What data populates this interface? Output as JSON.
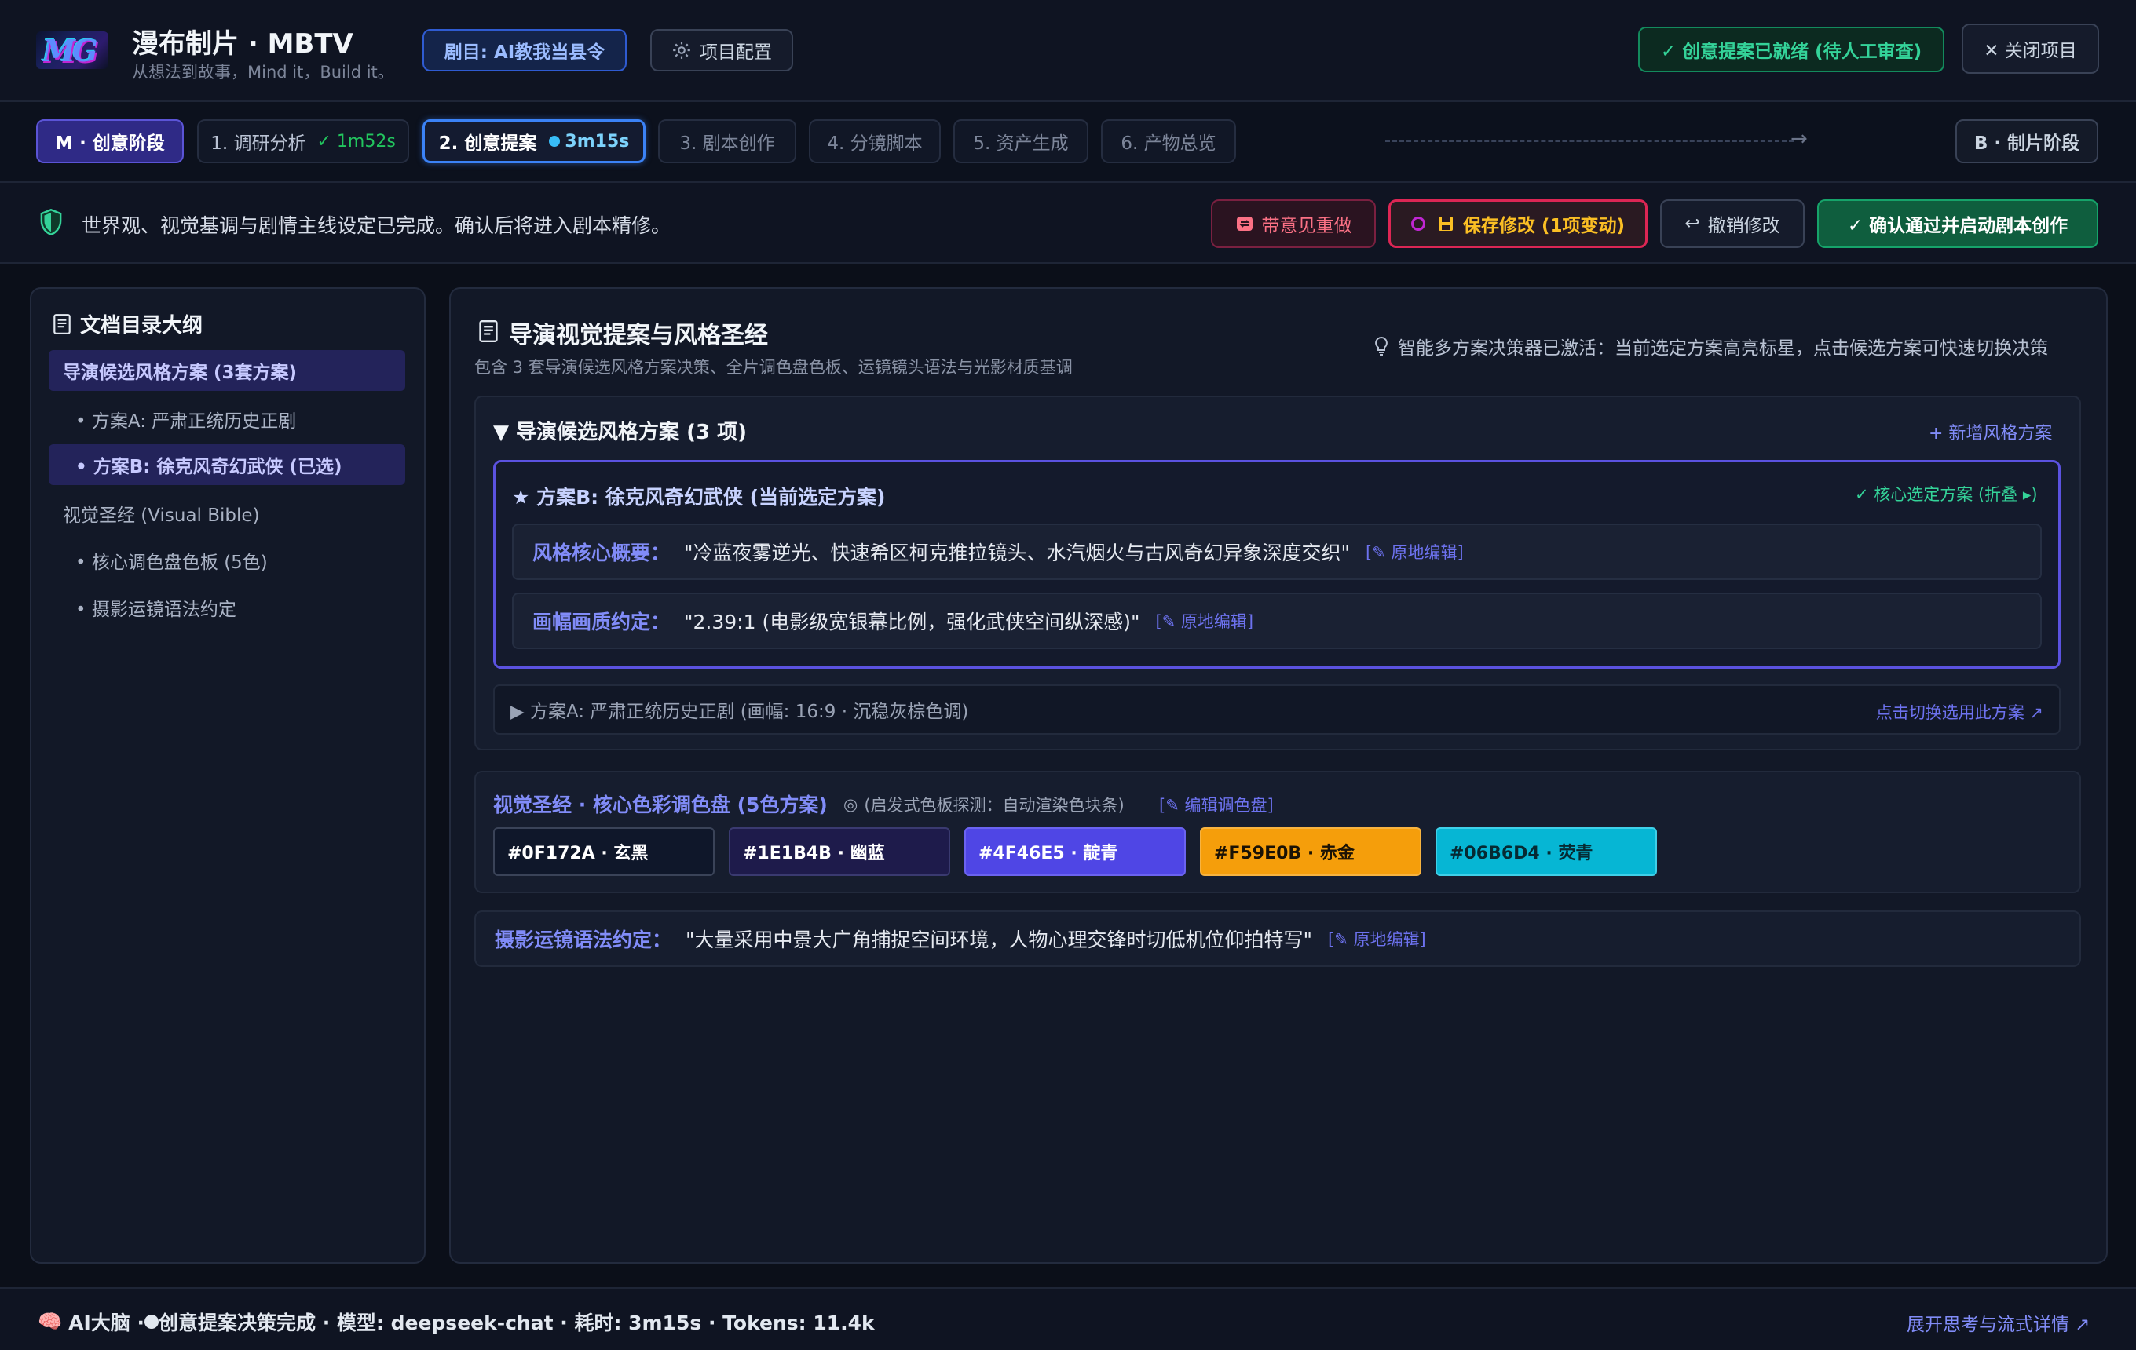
{
  "header": {
    "logo_text": "MG",
    "app_title": "漫布制片 · MBTV",
    "app_subtitle": "从想法到故事，Mind it，Build it。",
    "drama_chip": "剧目: AI教我当县令",
    "project_config": "项目配置",
    "ready_status": "✓ 创意提案已就绪 (待人工审查)",
    "close_project": "✕ 关闭项目"
  },
  "stages": {
    "m_stage": "M · 创意阶段",
    "b_stage": "B · 制片阶段",
    "steps": [
      {
        "label": "1. 调研分析",
        "time": "✓ 1m52s",
        "state": "done"
      },
      {
        "label": "2. 创意提案",
        "time": "3m15s",
        "state": "active"
      },
      {
        "label": "3. 剧本创作",
        "state": "pending"
      },
      {
        "label": "4. 分镜脚本",
        "state": "pending"
      },
      {
        "label": "5. 资产生成",
        "state": "pending"
      },
      {
        "label": "6. 产物总览",
        "state": "pending"
      }
    ]
  },
  "action_bar": {
    "message": "世界观、视觉基调与剧情主线设定已完成。确认后将进入剧本精修。",
    "redo": "带意见重做",
    "save": "保存修改 (1项变动)",
    "undo": "撤销修改",
    "confirm": "✓ 确认通过并启动剧本创作"
  },
  "sidebar": {
    "title": "文档目录大纲",
    "items": [
      {
        "label": "导演候选风格方案 (3套方案)",
        "active": true,
        "sub": false
      },
      {
        "label": "• 方案A: 严肃正统历史正剧",
        "active": false,
        "sub": true
      },
      {
        "label": "• 方案B: 徐克风奇幻武侠 (已选)",
        "active": true,
        "sub": true
      },
      {
        "label": "视觉圣经 (Visual Bible)",
        "active": false,
        "sub": false
      },
      {
        "label": "• 核心调色盘色板 (5色)",
        "active": false,
        "sub": true
      },
      {
        "label": "• 摄影运镜语法约定",
        "active": false,
        "sub": true
      }
    ]
  },
  "main": {
    "title": "导演视觉提案与风格圣经",
    "subtitle": "包含 3 套导演候选风格方案决策、全片调色盘色板、运镜镜头语法与光影材质基调",
    "hint": "智能多方案决策器已激活：当前选定方案高亮标星，点击候选方案可快速切换决策",
    "group_title": "▼ 导演候选风格方案 (3 项)",
    "add_style": "+ 新增风格方案",
    "selected": {
      "title": "★ 方案B: 徐克风奇幻武侠 (当前选定方案)",
      "badge": "✓ 核心选定方案 (折叠 ▸)",
      "fields": [
        {
          "label": "风格核心概要：",
          "value": "\"冷蓝夜雾逆光、快速希区柯克推拉镜头、水汽烟火与古风奇幻异象深度交织\"",
          "edit": "[✎ 原地编辑]"
        },
        {
          "label": "画幅画质约定：",
          "value": "\"2.39:1 (电影级宽银幕比例，强化武侠空间纵深感)\"",
          "edit": "[✎ 原地编辑]"
        }
      ]
    },
    "alternative": {
      "label": "▶ 方案A: 严肃正统历史正剧 (画幅: 16:9 · 沉稳灰棕色调)",
      "switch": "点击切换选用此方案 ↗"
    },
    "palette": {
      "title": "视觉圣经 · 核心色彩调色盘 (5色方案)",
      "note": "(启发式色板探测：自动渲染色块条)",
      "edit": "[✎ 编辑调色盘]",
      "swatches": [
        {
          "label": "#0F172A · 玄黑",
          "bg": "#0F172A",
          "fg": "#ffffff",
          "border": "#3a4358"
        },
        {
          "label": "#1E1B4B · 幽蓝",
          "bg": "#1E1B4B",
          "fg": "#ffffff",
          "border": "#3a3a70"
        },
        {
          "label": "#4F46E5 · 靛青",
          "bg": "#4F46E5",
          "fg": "#ffffff",
          "border": "#6b63f0"
        },
        {
          "label": "#F59E0B · 赤金",
          "bg": "#F59E0B",
          "fg": "#1a1205",
          "border": "#f7b340"
        },
        {
          "label": "#06B6D4 · 荧青",
          "bg": "#06B6D4",
          "fg": "#062a33",
          "border": "#3fd0e8"
        }
      ]
    },
    "camera": {
      "label": "摄影运镜语法约定：",
      "value": "\"大量采用中景大广角捕捉空间环境，人物心理交锋时切低机位仰拍特写\"",
      "edit": "[✎ 原地编辑]"
    }
  },
  "footer": {
    "prefix": "AI大脑 · ",
    "status": " 创意提案决策完成 · 模型: deepseek-chat · 耗时: 3m15s · Tokens: 11.4k",
    "link": "展开思考与流式详情 ↗"
  }
}
